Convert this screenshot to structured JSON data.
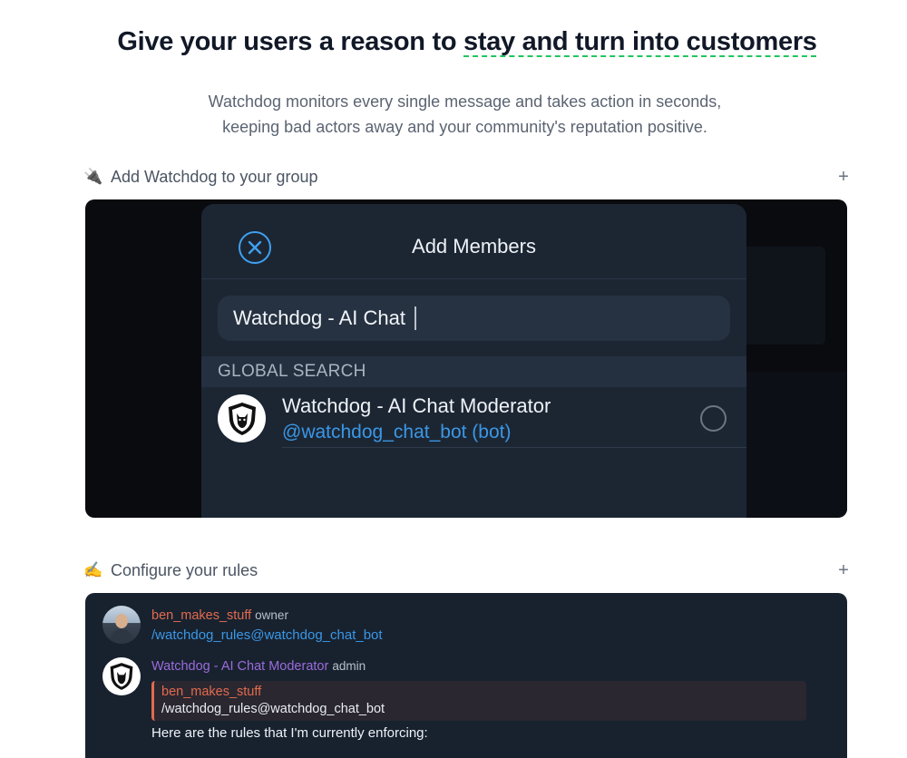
{
  "hero": {
    "headline_plain": "Give your users a reason to ",
    "headline_accent": "stay and turn into customers",
    "subtitle_line1": "Watchdog monitors every single message and takes action in seconds,",
    "subtitle_line2": "keeping bad actors away and your community's reputation positive."
  },
  "sections": [
    {
      "emoji": "🔌",
      "title": "Add Watchdog to your group",
      "toggle": "+"
    },
    {
      "emoji": "✍️",
      "title": "Configure your rules",
      "toggle": "+"
    }
  ],
  "add_members": {
    "title": "Add Members",
    "search_value": "Watchdog - AI Chat",
    "global_search_label": "GLOBAL SEARCH",
    "result": {
      "name": "Watchdog - AI Chat Moderator",
      "handle": "@watchdog_chat_bot (bot)"
    }
  },
  "chat": {
    "messages": [
      {
        "author": "ben_makes_stuff",
        "role": "owner",
        "text": "/watchdog_rules@watchdog_chat_bot"
      },
      {
        "author": "Watchdog - AI Chat Moderator",
        "role": "admin",
        "reply_to": {
          "author": "ben_makes_stuff",
          "text": "/watchdog_rules@watchdog_chat_bot"
        },
        "text": "Here are the rules that I'm currently enforcing:"
      }
    ]
  },
  "colors": {
    "accent_green": "#22c55e",
    "telegram_blue": "#3a97e6",
    "dark_panel": "#18222f",
    "owner_name": "#e26a4e",
    "bot_name": "#9b6bdb"
  },
  "icons": [
    "plug-icon",
    "writing-hand-icon",
    "plus-icon",
    "close-circle-icon",
    "watchdog-shield-logo",
    "radio-icon"
  ]
}
